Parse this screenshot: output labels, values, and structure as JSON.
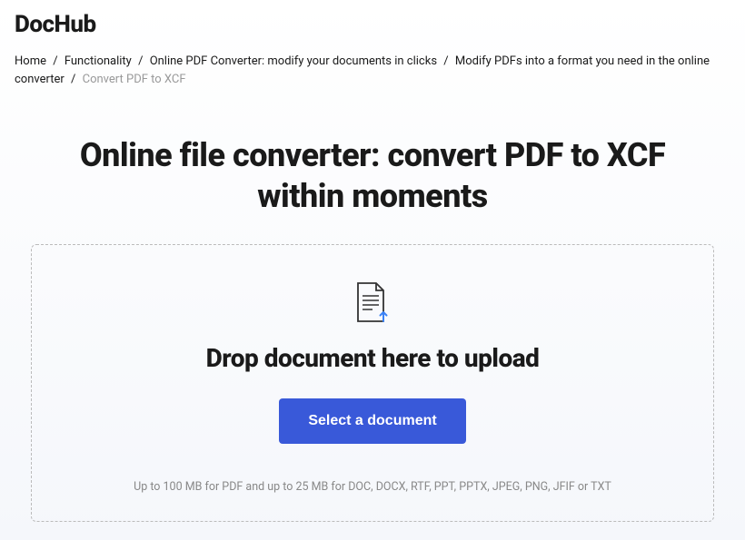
{
  "logo": "DocHub",
  "breadcrumb": {
    "items": [
      {
        "label": "Home"
      },
      {
        "label": "Functionality"
      },
      {
        "label": "Online PDF Converter: modify your documents in clicks"
      },
      {
        "label": "Modify PDFs into a format you need in the online converter"
      }
    ],
    "current": "Convert PDF to XCF"
  },
  "title": "Online file converter: convert PDF to XCF within moments",
  "dropzone": {
    "heading": "Drop document here to upload",
    "button_label": "Select a document",
    "limits": "Up to 100 MB for PDF and up to 25 MB for DOC, DOCX, RTF, PPT, PPTX, JPEG, PNG, JFIF or TXT"
  }
}
